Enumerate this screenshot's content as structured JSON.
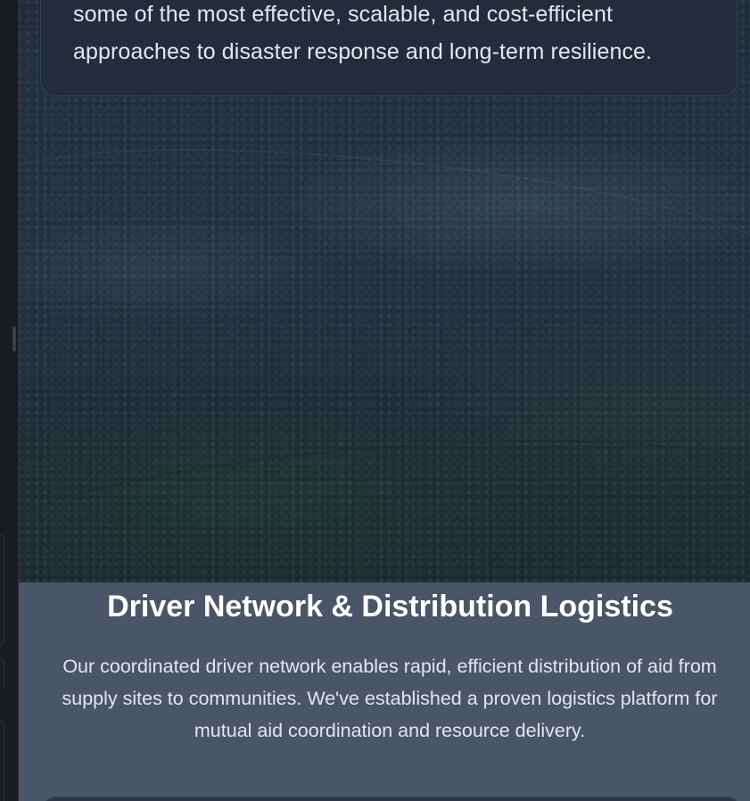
{
  "intro_card": {
    "text_line1": "some of the most effective, scalable, and cost-efficient",
    "text_line2": "approaches to disaster response and long-term resilience."
  },
  "driver_section": {
    "title": "Driver Network & Distribution Logistics",
    "description": "Our coordinated driver network enables rapid, efficient distribution of aid from supply sites to communities. We've established a proven logistics platform for mutual aid coordination and resource delivery."
  },
  "colors": {
    "section_background": "#4a5568",
    "card_background": "#242c3c",
    "title_text": "#ffffff",
    "body_text": "#e2e6ec"
  }
}
